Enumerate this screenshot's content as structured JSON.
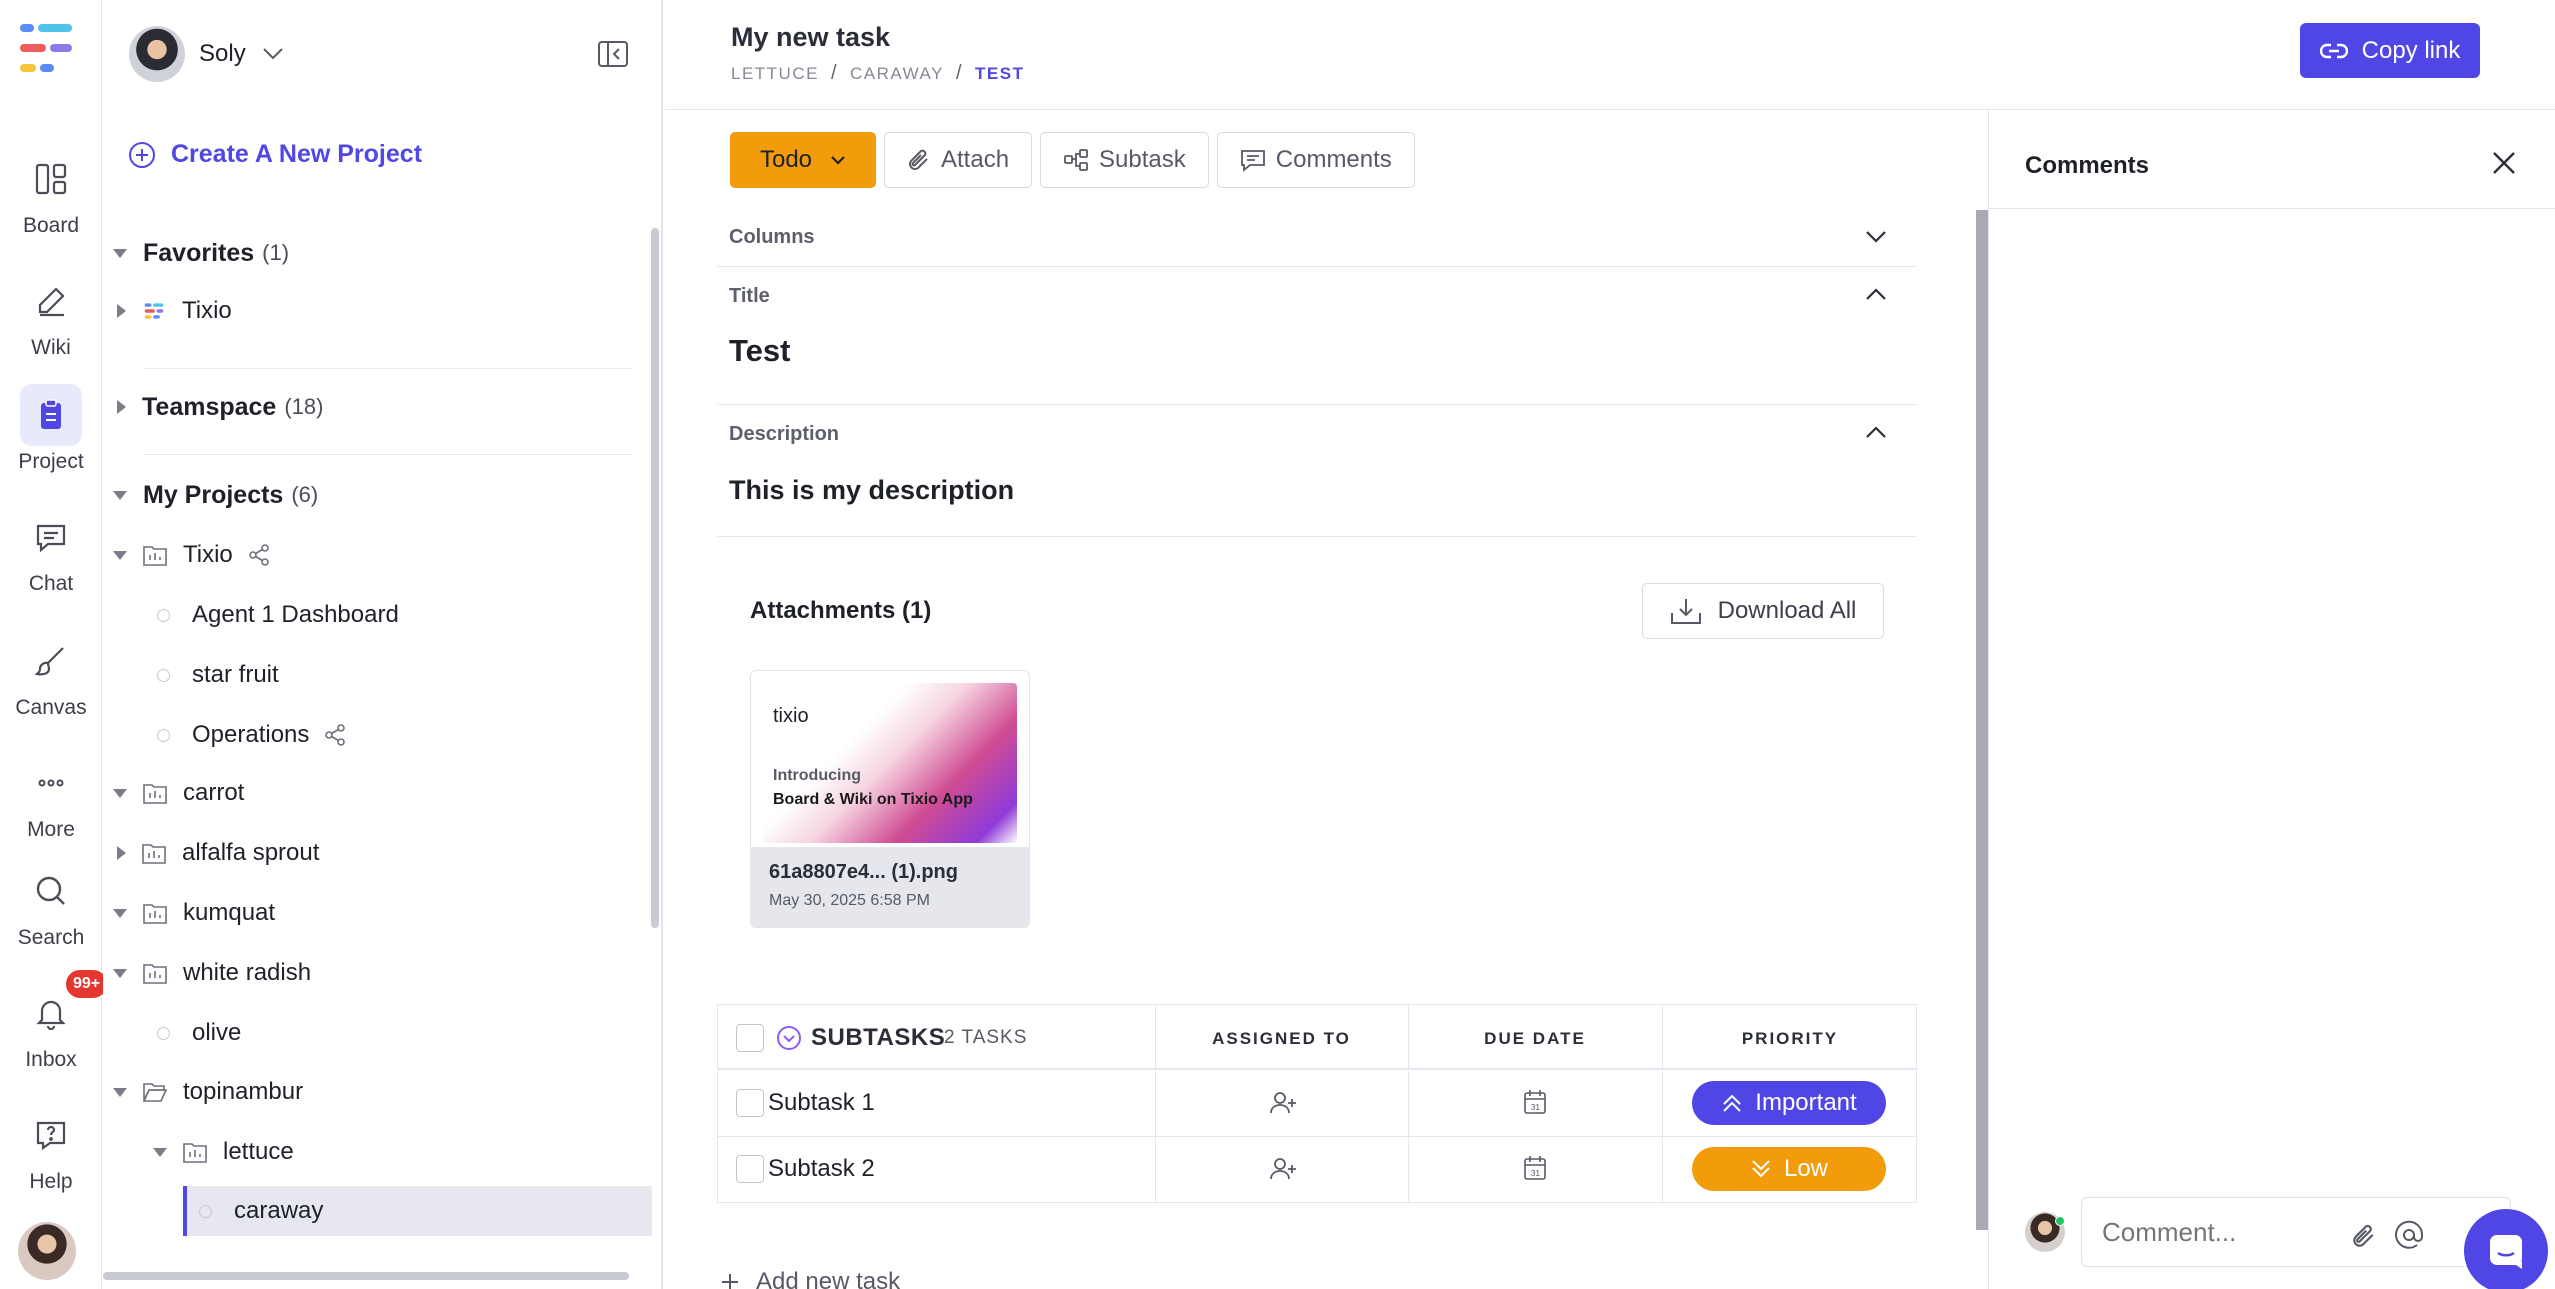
{
  "rail": {
    "items": [
      {
        "label": "Board",
        "icon": "board-icon"
      },
      {
        "label": "Wiki",
        "icon": "pencil-icon"
      },
      {
        "label": "Project",
        "icon": "clipboard-icon",
        "active": true
      },
      {
        "label": "Chat",
        "icon": "chat-icon"
      },
      {
        "label": "Canvas",
        "icon": "brush-icon"
      },
      {
        "label": "More",
        "icon": "more-icon"
      },
      {
        "label": "Search",
        "icon": "search-icon"
      },
      {
        "label": "Inbox",
        "icon": "bell-icon"
      },
      {
        "label": "Help",
        "icon": "help-icon"
      }
    ],
    "inbox_badge": "99+"
  },
  "sidebar": {
    "workspace_name": "Soly",
    "create_project": "Create A New Project",
    "favorites": {
      "label": "Favorites",
      "count": "(1)",
      "items": [
        "Tixio"
      ]
    },
    "teamspace": {
      "label": "Teamspace",
      "count": "(18)"
    },
    "my_projects": {
      "label": "My Projects",
      "count": "(6)"
    },
    "tree": [
      "Tixio",
      "Agent 1 Dashboard",
      "star fruit",
      "Operations",
      "carrot",
      "alfalfa sprout",
      "kumquat",
      "white radish",
      "olive",
      "topinambur",
      "lettuce",
      "caraway"
    ]
  },
  "header": {
    "task_title": "My new task",
    "breadcrumb": [
      "LETTUCE",
      "CARAWAY",
      "TEST"
    ],
    "copy_link": "Copy link"
  },
  "toolbar": {
    "status": "Todo",
    "attach": "Attach",
    "subtask": "Subtask",
    "comments": "Comments"
  },
  "task": {
    "columns_label": "Columns",
    "title_label": "Title",
    "title_value": "Test",
    "description_label": "Description",
    "description_value": "This is my description"
  },
  "attachments": {
    "title": "Attachments (1)",
    "download_all": "Download All",
    "file": {
      "name": "61a8807e4... (1).png",
      "date": "May 30, 2025 6:58 PM",
      "preview_brand": "tixio",
      "preview_line1": "Introducing",
      "preview_line2": "Board & Wiki on Tixio App"
    }
  },
  "subtasks": {
    "title": "SUBTASKS",
    "count": "2 TASKS",
    "columns": [
      "ASSIGNED TO",
      "DUE DATE",
      "PRIORITY"
    ],
    "rows": [
      {
        "name": "Subtask 1",
        "priority": "Important",
        "priority_color": "#4f46e5"
      },
      {
        "name": "Subtask 2",
        "priority": "Low",
        "priority_color": "#f29b0b"
      }
    ],
    "add_new": "Add new task"
  },
  "comments_panel": {
    "title": "Comments",
    "placeholder": "Comment..."
  },
  "colors": {
    "accent": "#4f46e5",
    "status_todo": "#f29b0b"
  }
}
